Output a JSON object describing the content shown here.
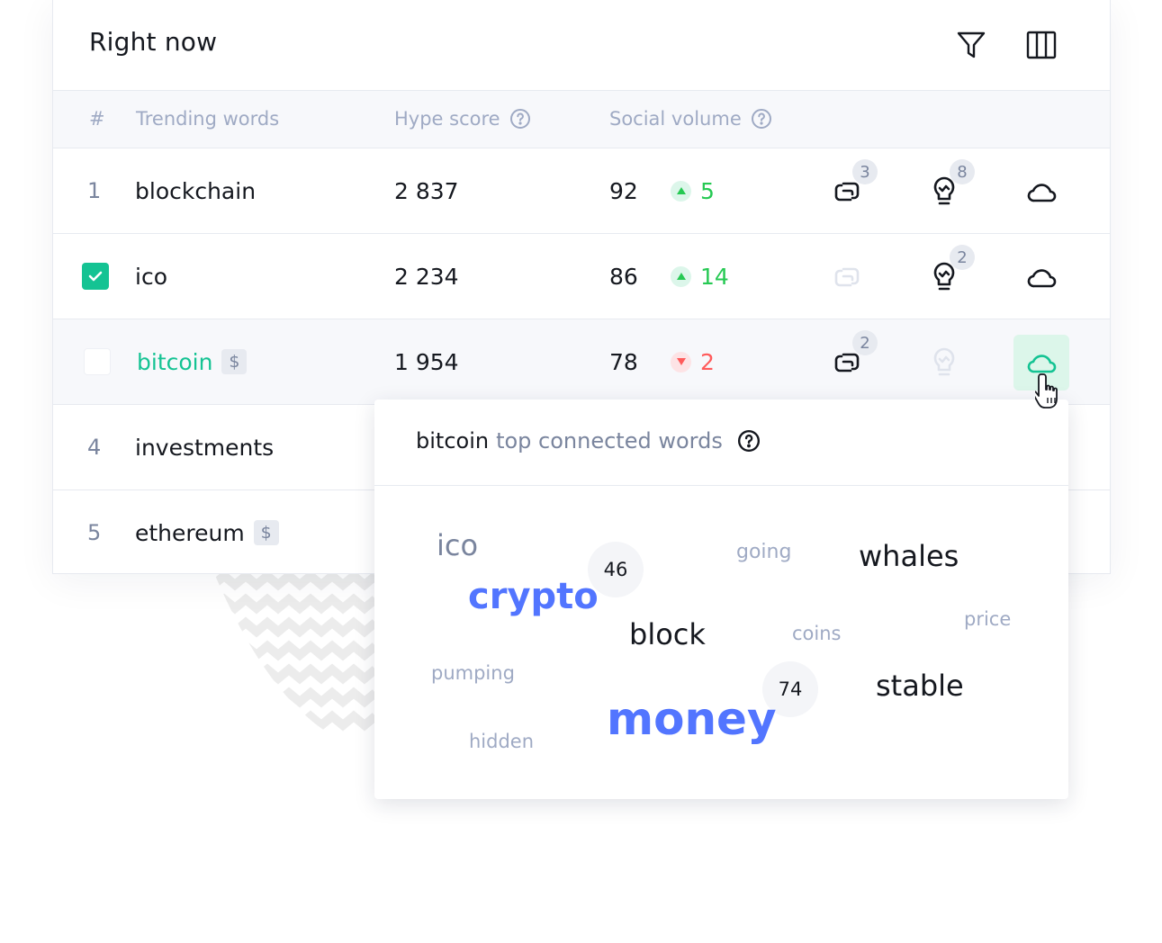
{
  "card": {
    "title": "Right now"
  },
  "table": {
    "headers": {
      "rank": "#",
      "word": "Trending words",
      "hype": "Hype score",
      "social": "Social volume"
    },
    "rows": [
      {
        "rank": "1",
        "word": "blockchain",
        "has_dollar": false,
        "hype": "2 837",
        "volume": "92",
        "change": "5",
        "direction": "up",
        "insights_count": "3",
        "ideas_count": "8",
        "selected": false,
        "highlighted": false
      },
      {
        "rank": "",
        "word": "ico",
        "has_dollar": false,
        "hype": "2 234",
        "volume": "86",
        "change": "14",
        "direction": "up",
        "insights_count": "",
        "ideas_count": "2",
        "selected": true,
        "highlighted": false
      },
      {
        "rank": "",
        "word": "bitcoin",
        "has_dollar": true,
        "dollar": "$",
        "hype": "1 954",
        "volume": "78",
        "change": "2",
        "direction": "down",
        "insights_count": "2",
        "ideas_count": "",
        "selected": false,
        "highlighted": true
      },
      {
        "rank": "4",
        "word": "investments",
        "has_dollar": false
      },
      {
        "rank": "5",
        "word": "ethereum",
        "has_dollar": true,
        "dollar": "$"
      }
    ]
  },
  "popup": {
    "word": "bitcoin",
    "title_rest": "top connected words",
    "cloud": [
      {
        "text": "ico",
        "color": "#7a859e"
      },
      {
        "text": "crypto",
        "color": "#5275ff"
      },
      {
        "text": "going",
        "color": "#9faac4"
      },
      {
        "text": "whales",
        "color": "#15181f"
      },
      {
        "text": "block",
        "color": "#15181f"
      },
      {
        "text": "coins",
        "color": "#9faac4"
      },
      {
        "text": "price",
        "color": "#9faac4"
      },
      {
        "text": "pumping",
        "color": "#9faac4"
      },
      {
        "text": "stable",
        "color": "#15181f"
      },
      {
        "text": "money",
        "color": "#5275ff"
      },
      {
        "text": "hidden",
        "color": "#9faac4"
      }
    ],
    "bubbles": [
      "46",
      "74"
    ]
  },
  "colors": {
    "accent": "#14c393",
    "up": "#26c953",
    "down": "#ff5b5b",
    "word_blue": "#5275ff"
  }
}
